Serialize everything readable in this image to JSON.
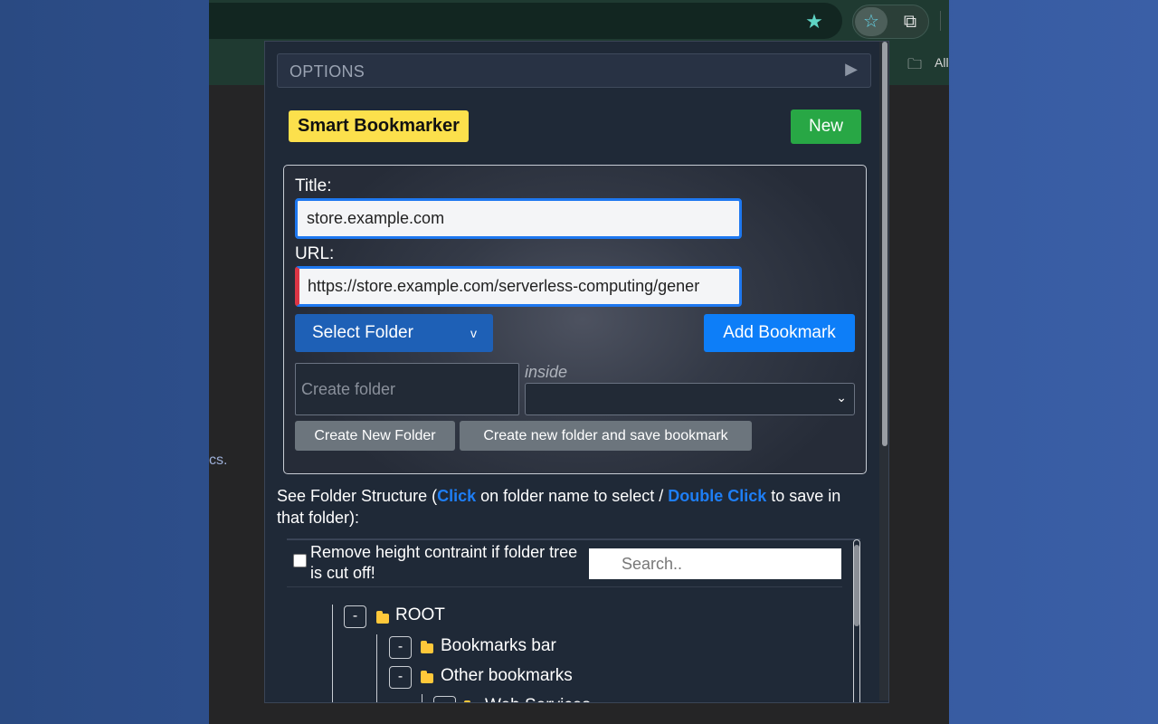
{
  "browser": {
    "bookmarks_bar_all": "All",
    "page_text_fragment": "cs."
  },
  "popup": {
    "options_label": "OPTIONS",
    "app_title": "Smart Bookmarker",
    "new_button": "New",
    "form": {
      "title_label": "Title:",
      "title_value": "store.example.com",
      "url_label": "URL:",
      "url_value": "https://store.example.com/serverless-computing/gener",
      "select_folder_label": "Select Folder",
      "select_folder_caret": "v",
      "add_bookmark_label": "Add Bookmark",
      "create_folder_placeholder": "Create folder",
      "inside_label": "inside",
      "create_new_folder_label": "Create New Folder",
      "create_and_save_label": "Create new folder and save bookmark"
    },
    "folder_info": {
      "prefix": "See Folder Structure (",
      "click": "Click",
      "middle": " on folder name to select / ",
      "double_click": "Double Click",
      "suffix": " to save in that folder):"
    },
    "tree": {
      "height_checkbox_label": "Remove height contraint if folder tree is cut off!",
      "search_placeholder": "Search..",
      "nodes": [
        {
          "toggle": "-",
          "label": "ROOT"
        },
        {
          "toggle": "-",
          "label": "Bookmarks bar"
        },
        {
          "toggle": "-",
          "label": "Other bookmarks"
        },
        {
          "toggle": "-",
          "label": "Web Services"
        }
      ]
    }
  },
  "icons": {
    "star": "star-icon",
    "extension": "smart-bookmarker-extension-icon",
    "puzzle": "puzzle-icon",
    "folder": "folder-icon"
  },
  "colors": {
    "accent_yellow": "#fce04c",
    "new_green": "#28a745",
    "primary_blue": "#0d7ef8",
    "select_blue": "#1e60b6",
    "secondary_grey": "#6c757d",
    "highlight_blue": "#1e7ef5",
    "folder_yellow": "#ffc83a"
  }
}
